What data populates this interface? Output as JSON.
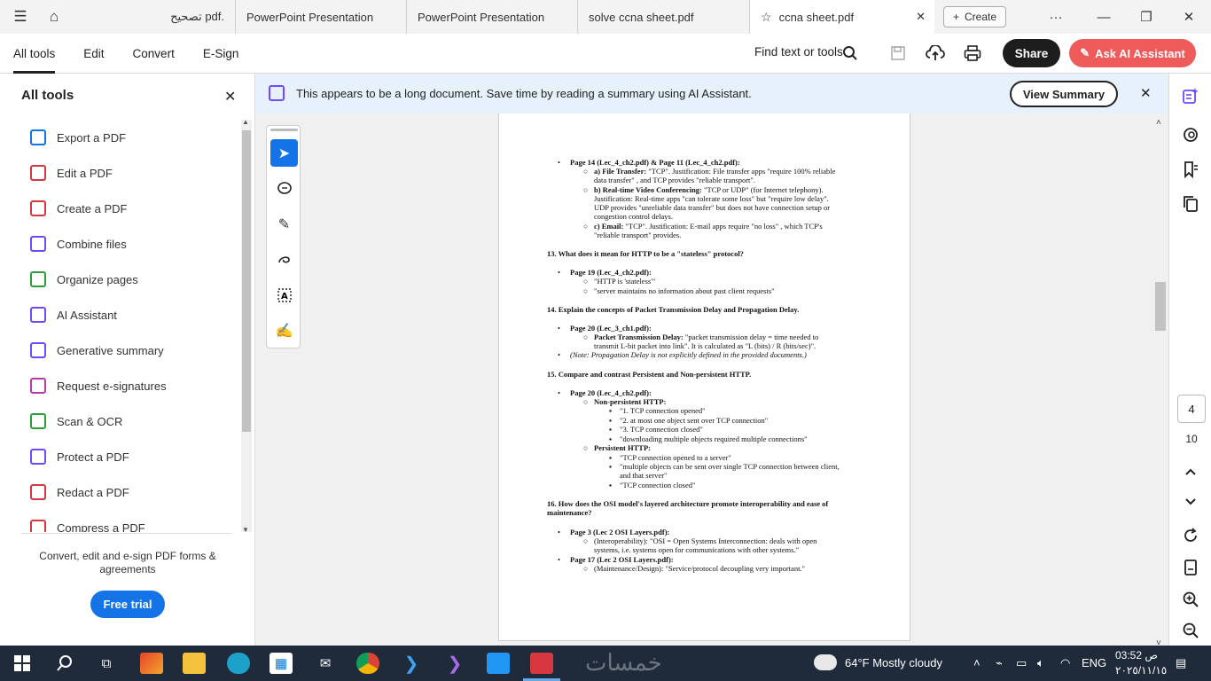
{
  "titlebar": {
    "tabs": [
      {
        "label": "تصحيح pdf."
      },
      {
        "label": "PowerPoint Presentation"
      },
      {
        "label": "PowerPoint Presentation"
      },
      {
        "label": "solve ccna sheet.pdf"
      },
      {
        "label": "ccna sheet.pdf"
      }
    ],
    "create_label": "Create"
  },
  "toolbar": {
    "menus": [
      "All tools",
      "Edit",
      "Convert",
      "E-Sign"
    ],
    "find_label": "Find text or tools",
    "share_label": "Share",
    "ai_label": "Ask AI Assistant"
  },
  "sidebar": {
    "title": "All tools",
    "items": [
      {
        "label": "Export a PDF",
        "icon": "export-pdf-icon",
        "color": "#1473e6"
      },
      {
        "label": "Edit a PDF",
        "icon": "edit-pdf-icon",
        "color": "#d7373f"
      },
      {
        "label": "Create a PDF",
        "icon": "create-pdf-icon",
        "color": "#d7373f"
      },
      {
        "label": "Combine files",
        "icon": "combine-files-icon",
        "color": "#6d4aff"
      },
      {
        "label": "Organize pages",
        "icon": "organize-pages-icon",
        "color": "#2d9d3a"
      },
      {
        "label": "AI Assistant",
        "icon": "ai-assistant-icon",
        "color": "#6d4aff"
      },
      {
        "label": "Generative summary",
        "icon": "generative-summary-icon",
        "color": "#6d4aff"
      },
      {
        "label": "Request e-signatures",
        "icon": "request-esign-icon",
        "color": "#b93aa6"
      },
      {
        "label": "Scan & OCR",
        "icon": "scan-ocr-icon",
        "color": "#2d9d3a"
      },
      {
        "label": "Protect a PDF",
        "icon": "protect-pdf-icon",
        "color": "#6d4aff"
      },
      {
        "label": "Redact a PDF",
        "icon": "redact-pdf-icon",
        "color": "#d7373f"
      },
      {
        "label": "Compress a PDF",
        "icon": "compress-pdf-icon",
        "color": "#d7373f"
      }
    ],
    "footer_text": "Convert, edit and e-sign PDF forms & agreements",
    "trial_label": "Free trial"
  },
  "banner": {
    "text": "This appears to be a long document. Save time by reading a summary using AI Assistant.",
    "button_label": "View Summary"
  },
  "document": {
    "lines": [
      "Page 14 (Lec_4_ch2.pdf) & Page 11 (Lec_4_ch2.pdf):",
      "a) File Transfer:",
      " \"TCP\". Justification: File transfer apps \"require 100% reliable",
      "data transfer\" , and TCP provides \"reliable transport\".",
      "b) Real-time Video Conferencing:",
      " \"TCP or UDP\" (for Internet telephony).",
      "Justification: Real-time apps \"can tolerate some loss\" but \"require low delay\".",
      "UDP provides \"unreliable data transfer\" but does not have connection setup or",
      "congestion control delays.",
      "c) Email:",
      " \"TCP\". Justification: E-mail apps require \"no loss\" , which TCP's",
      "\"reliable transport\" provides.",
      "13. What does it mean for HTTP to be a \"stateless\" protocol?",
      "Page 19 (Lec_4_ch2.pdf):",
      "\"HTTP is 'stateless'\"",
      "\"server maintains no information about past client requests\"",
      "14. Explain the concepts of Packet Transmission Delay and Propagation Delay.",
      "Page 20 (Lec_3_ch1.pdf):",
      "Packet Transmission Delay:",
      " \"packet transmission delay = time needed to",
      "transmit L-bit packet into link\". It is calculated as \"L (bits) / R (bits/sec)\".",
      "(Note: Propagation Delay is not explicitly defined in the provided documents.)",
      "15. Compare and contrast Persistent and Non-persistent HTTP.",
      "Page 20 (Lec_4_ch2.pdf):",
      "Non-persistent HTTP:",
      "\"1. TCP connection opened\"",
      "\"2. at most one object sent over TCP connection\"",
      "\"3. TCP connection closed\"",
      "\"downloading multiple objects required multiple connections\"",
      "Persistent HTTP:",
      "\"TCP connection opened to a server\"",
      "\"multiple objects can be sent over single TCP connection between client,",
      "and that server\"",
      "\"TCP connection closed\"",
      "16. How does the OSI model's layered architecture promote interoperability and ease of",
      "maintenance?",
      "Page 3 (Lec 2 OSI Layers.pdf):",
      "(Interoperability): \"OSI = Open Systems Interconnection: deals with open",
      "systems, i.e. systems open for communications with other systems.\"",
      "Page 17 (Lec 2 OSI Layers.pdf):",
      "(Maintenance/Design): \"Service/protocol decoupling very important.\""
    ]
  },
  "pager": {
    "current": "4",
    "total": "10"
  },
  "taskbar": {
    "weather": "64°F  Mostly cloudy",
    "lang": "ENG",
    "time": "03:52 ص",
    "date": "٢٠٢٥/١١/١٥",
    "watermark": "خمسات"
  }
}
